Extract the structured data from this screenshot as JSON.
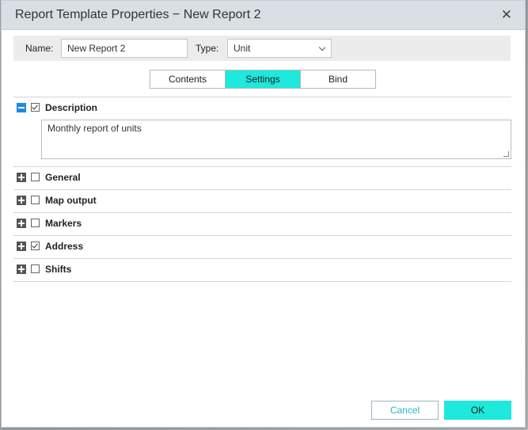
{
  "dialog": {
    "title": "Report Template Properties − New Report 2",
    "close_icon": "close-icon"
  },
  "fields": {
    "name_label": "Name:",
    "name_value": "New Report 2",
    "type_label": "Type:",
    "type_value": "Unit"
  },
  "tabs": [
    {
      "label": "Contents",
      "active": false
    },
    {
      "label": "Settings",
      "active": true
    },
    {
      "label": "Bind",
      "active": false
    }
  ],
  "sections": [
    {
      "label": "Description",
      "expanded": true,
      "checked": true
    },
    {
      "label": "General",
      "expanded": false,
      "checked": false
    },
    {
      "label": "Map output",
      "expanded": false,
      "checked": false
    },
    {
      "label": "Markers",
      "expanded": false,
      "checked": false
    },
    {
      "label": "Address",
      "expanded": false,
      "checked": true
    },
    {
      "label": "Shifts",
      "expanded": false,
      "checked": false
    }
  ],
  "description_text": "Monthly report of units",
  "buttons": {
    "cancel": "Cancel",
    "ok": "OK"
  },
  "colors": {
    "accent": "#1de9dc",
    "titlebar": "#d9dfe4",
    "minus_icon": "#1e88e5"
  }
}
